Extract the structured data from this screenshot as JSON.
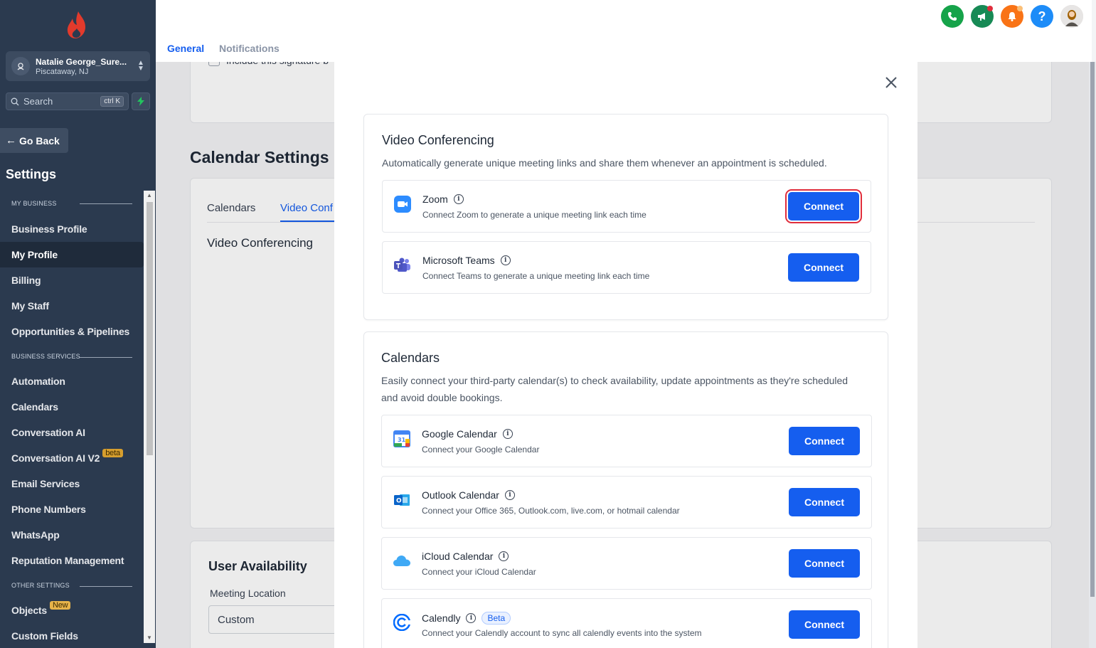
{
  "sidebar": {
    "account": {
      "name": "Natalie George_Sure...",
      "location": "Piscataway, NJ"
    },
    "search": {
      "label": "Search",
      "shortcut": "ctrl K"
    },
    "go_back": "Go Back",
    "title": "Settings",
    "sections": {
      "my_business": "MY BUSINESS",
      "business_services": "BUSINESS SERVICES",
      "other_settings": "OTHER SETTINGS"
    },
    "items": [
      "Business Profile",
      "My Profile",
      "Billing",
      "My Staff",
      "Opportunities & Pipelines",
      "Automation",
      "Calendars",
      "Conversation AI",
      "Conversation AI V2",
      "Email Services",
      "Phone Numbers",
      "WhatsApp",
      "Reputation Management",
      "Objects",
      "Custom Fields"
    ],
    "badges": {
      "beta": "beta",
      "new": "New"
    }
  },
  "header": {
    "tabs": [
      "General",
      "Notifications"
    ],
    "icons": [
      "phone-icon",
      "megaphone-icon",
      "bell-icon",
      "help-icon",
      "user-avatar"
    ]
  },
  "background": {
    "checkbox_label": "Include this signature b",
    "calendar_settings_title": "Calendar Settings",
    "tabs": [
      "Calendars",
      "Video Conf"
    ],
    "video_conferencing_heading": "Video Conferencing",
    "user_availability_title": "User Availability",
    "meeting_location_label": "Meeting Location",
    "meeting_location_value": "Custom"
  },
  "modal": {
    "video": {
      "title": "Video Conferencing",
      "description": "Automatically generate unique meeting links and share them whenever an appointment is scheduled.",
      "items": [
        {
          "name": "Zoom",
          "desc": "Connect Zoom to generate a unique meeting link each time",
          "button": "Connect"
        },
        {
          "name": "Microsoft Teams",
          "desc": "Connect Teams to generate a unique meeting link each time",
          "button": "Connect"
        }
      ]
    },
    "calendars": {
      "title": "Calendars",
      "description": "Easily connect your third-party calendar(s) to check availability, update appointments as they're scheduled and avoid double bookings.",
      "items": [
        {
          "name": "Google Calendar",
          "desc": "Connect your Google Calendar",
          "button": "Connect",
          "icon_text": "31"
        },
        {
          "name": "Outlook Calendar",
          "desc": "Connect your Office 365, Outlook.com, live.com, or hotmail calendar",
          "button": "Connect"
        },
        {
          "name": "iCloud Calendar",
          "desc": "Connect your iCloud Calendar",
          "button": "Connect"
        },
        {
          "name": "Calendly",
          "desc": "Connect your Calendly account to sync all calendly events into the system",
          "button": "Connect",
          "badge": "Beta"
        }
      ]
    }
  },
  "colors": {
    "primary": "#155eef",
    "sidebar": "#2b3a4f",
    "highlight": "#e02d3c"
  }
}
